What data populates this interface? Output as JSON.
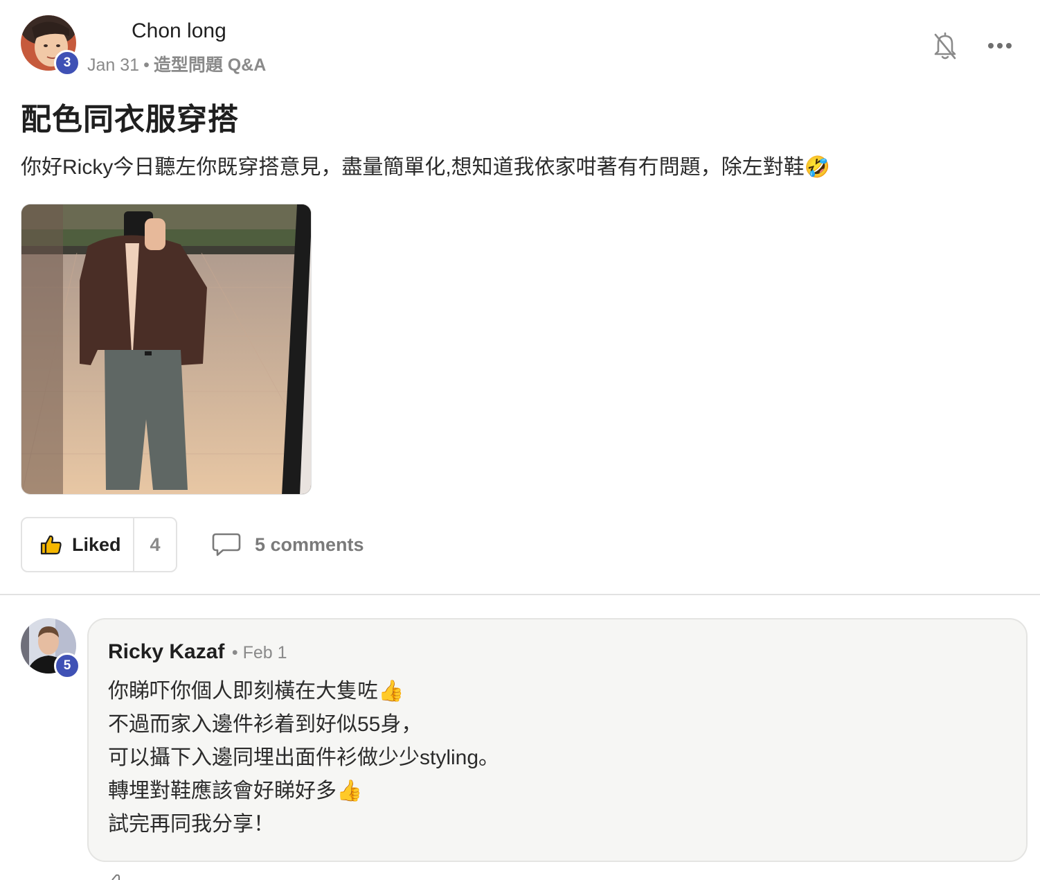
{
  "post": {
    "author": "Chon long",
    "author_level": "3",
    "date": "Jan 31",
    "separator": "•",
    "category": "造型問題 Q&A",
    "title": "配色同衣服穿搭",
    "body": "你好Ricky今日聽左你既穿搭意見，盡量簡單化,想知道我依家咁著有冇問題，除左對鞋🤣",
    "image_icon": "mirror-selfie-photo"
  },
  "header_actions": {
    "bell_icon": "bell-off-icon",
    "more_icon": "more-horizontal-icon"
  },
  "actions": {
    "like_label": "Liked",
    "like_count": "4",
    "comments_label": "5 comments"
  },
  "comments": [
    {
      "author": "Ricky Kazaf",
      "author_level": "5",
      "separator": "•",
      "date": "Feb 1",
      "lines": [
        "你睇吓你個人即刻橫在大隻咗👍",
        "不過而家入邊件衫着到好似55身，",
        "可以攝下入邊同埋出面件衫做少少styling。",
        "轉埋對鞋應該會好睇好多👍",
        "試完再同我分享！"
      ]
    }
  ],
  "colors": {
    "badge": "#3f51b5",
    "muted_text": "#8a8a8a",
    "bubble_bg": "#f6f6f4",
    "like_icon_fill": "#f5b700"
  }
}
